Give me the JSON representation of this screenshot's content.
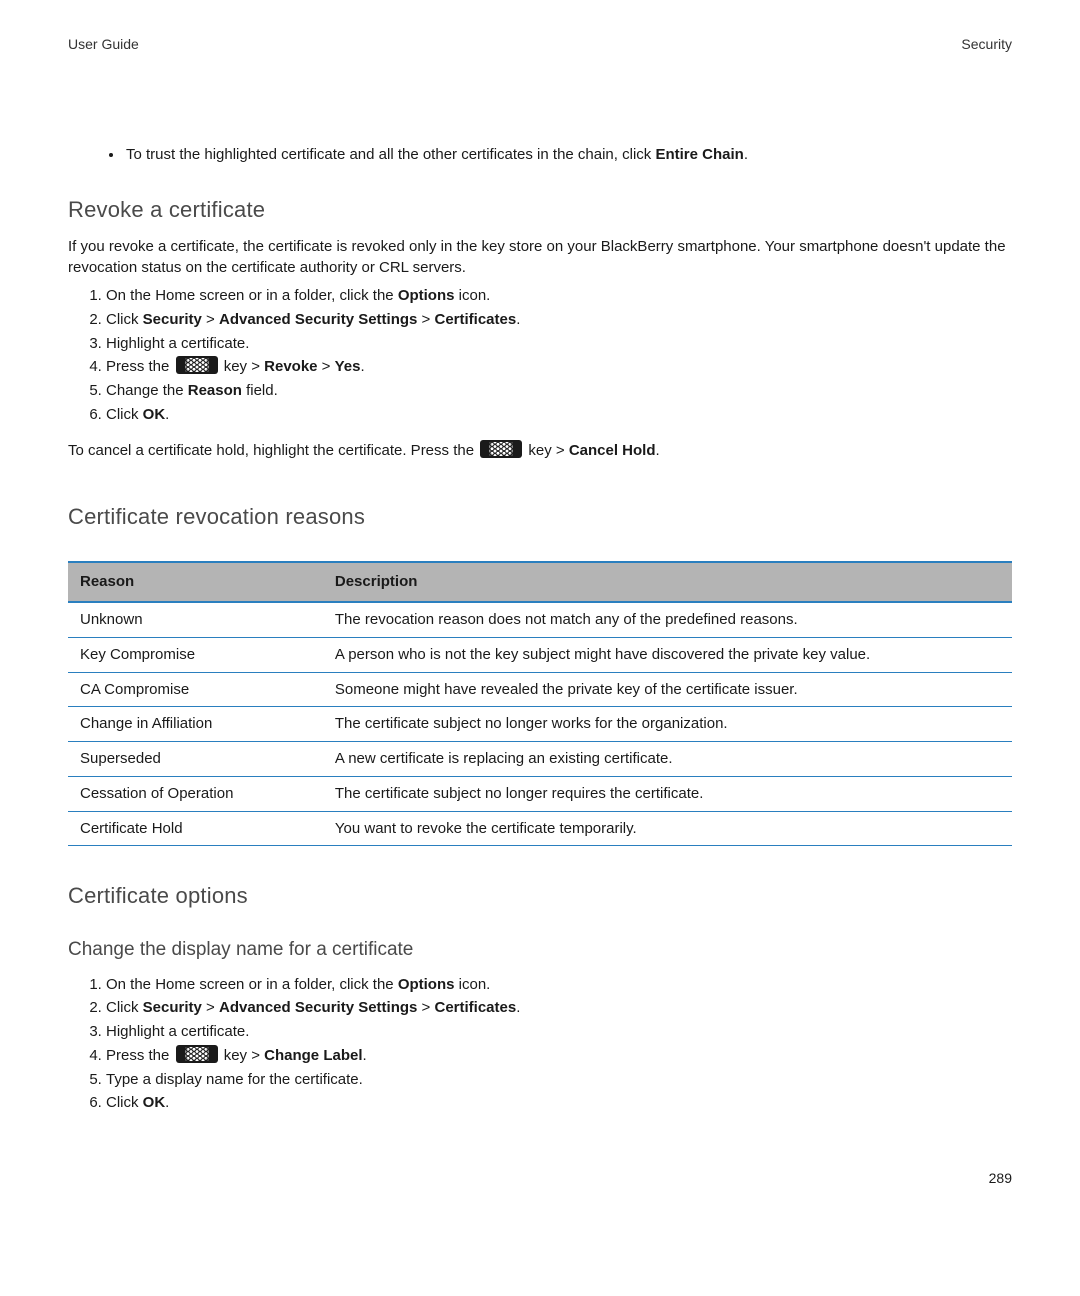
{
  "header": {
    "left": "User Guide",
    "right": "Security"
  },
  "intro_bullet": {
    "pre": "To trust the highlighted certificate and all the other certificates in the chain, click ",
    "bold": "Entire Chain",
    "post": "."
  },
  "revoke": {
    "heading": "Revoke a certificate",
    "para": "If you revoke a certificate, the certificate is revoked only in the key store on your BlackBerry smartphone. Your smartphone doesn't update the revocation status on the certificate authority or CRL servers.",
    "steps": {
      "s1": {
        "pre": "On the Home screen or in a folder, click the ",
        "bold": "Options",
        "post": " icon."
      },
      "s2": {
        "pre": "Click ",
        "b1": "Security",
        "gt1": " > ",
        "b2": "Advanced Security Settings",
        "gt2": " > ",
        "b3": "Certificates",
        "post": "."
      },
      "s3": "Highlight a certificate.",
      "s4": {
        "pre": "Press the ",
        "mid": " key > ",
        "b1": "Revoke",
        "gt": " > ",
        "b2": "Yes",
        "post": "."
      },
      "s5": {
        "pre": "Change the ",
        "bold": "Reason",
        "post": " field."
      },
      "s6": {
        "pre": "Click ",
        "bold": "OK",
        "post": "."
      }
    },
    "cancel": {
      "pre": "To cancel a certificate hold, highlight the certificate. Press the ",
      "mid": " key > ",
      "bold": "Cancel Hold",
      "post": "."
    }
  },
  "reasons_heading": "Certificate revocation reasons",
  "table": {
    "headers": {
      "reason": "Reason",
      "desc": "Description"
    },
    "rows": [
      {
        "reason": "Unknown",
        "desc": "The revocation reason does not match any of the predefined reasons."
      },
      {
        "reason": "Key Compromise",
        "desc": "A person who is not the key subject might have discovered the private key value."
      },
      {
        "reason": "CA Compromise",
        "desc": "Someone might have revealed the private key of the certificate issuer."
      },
      {
        "reason": "Change in Affiliation",
        "desc": "The certificate subject no longer works for the organization."
      },
      {
        "reason": "Superseded",
        "desc": "A new certificate is replacing an existing certificate."
      },
      {
        "reason": "Cessation of Operation",
        "desc": "The certificate subject no longer requires the certificate."
      },
      {
        "reason": "Certificate Hold",
        "desc": "You want to revoke the certificate temporarily."
      }
    ]
  },
  "options_heading": "Certificate options",
  "change_name": {
    "heading": "Change the display name for a certificate",
    "steps": {
      "s1": {
        "pre": "On the Home screen or in a folder, click the ",
        "bold": "Options",
        "post": " icon."
      },
      "s2": {
        "pre": "Click ",
        "b1": "Security",
        "gt1": " > ",
        "b2": "Advanced Security Settings",
        "gt2": " > ",
        "b3": "Certificates",
        "post": "."
      },
      "s3": "Highlight a certificate.",
      "s4": {
        "pre": "Press the ",
        "mid": " key > ",
        "bold": "Change Label",
        "post": "."
      },
      "s5": "Type a display name for the certificate.",
      "s6": {
        "pre": "Click ",
        "bold": "OK",
        "post": "."
      }
    }
  },
  "page_number": "289"
}
